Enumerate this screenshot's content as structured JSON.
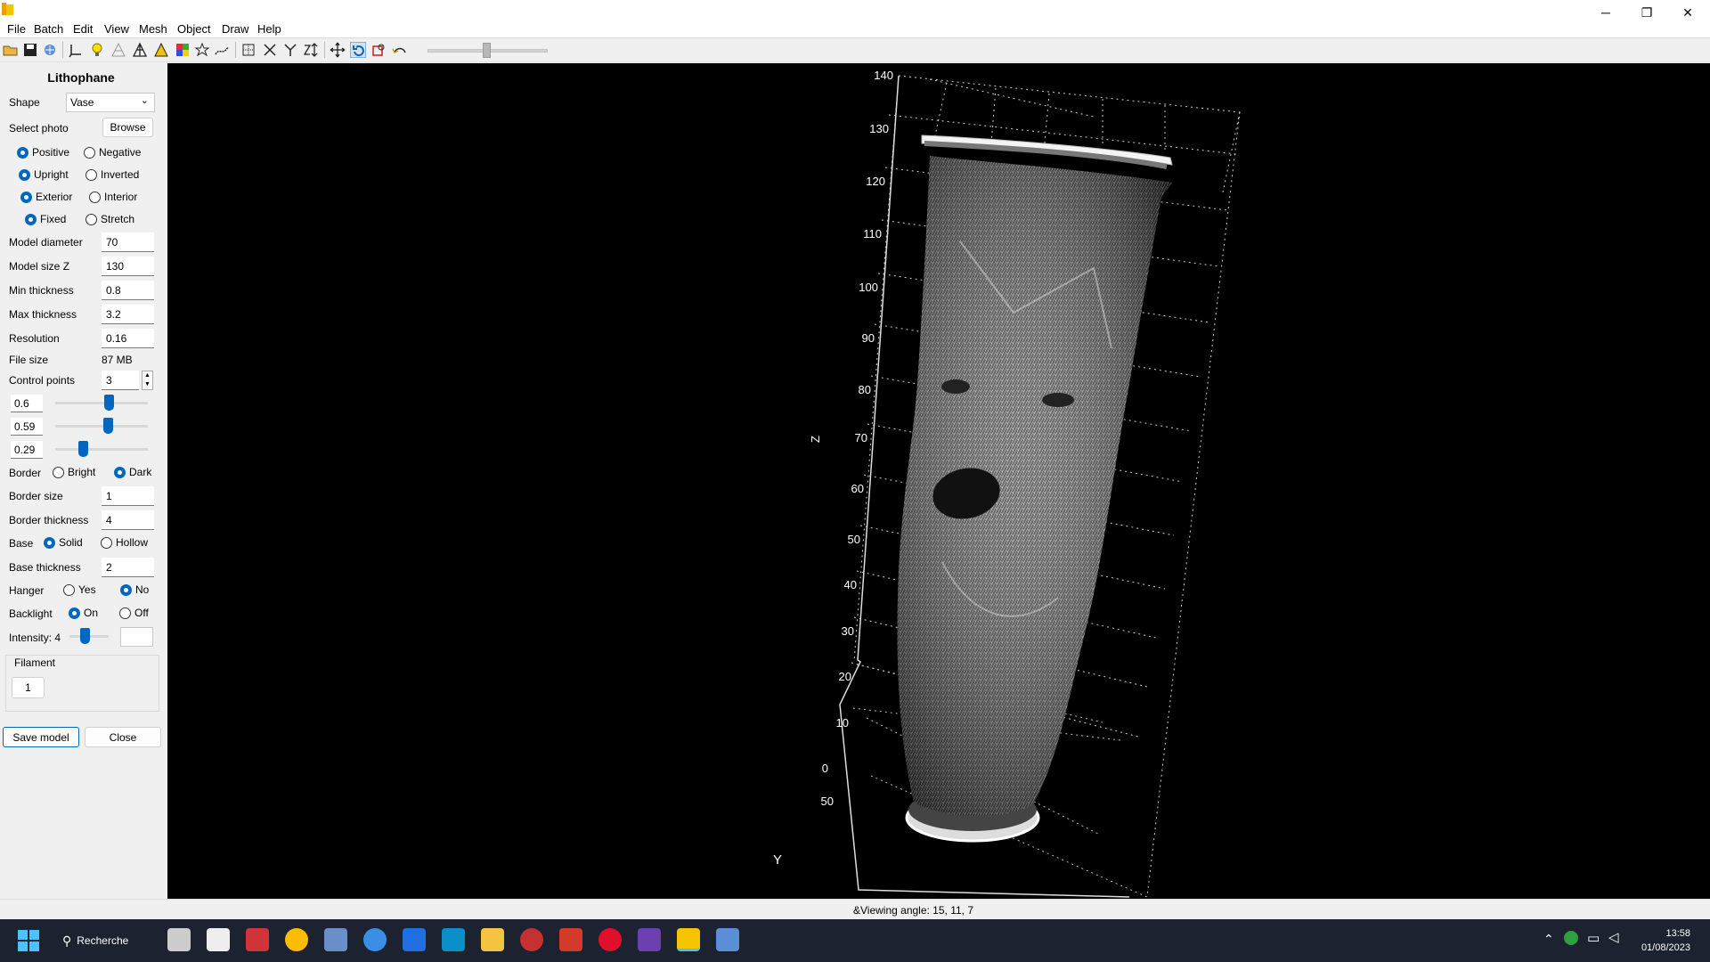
{
  "window": {
    "minimize": "─",
    "maximize": "❐",
    "close": "✕"
  },
  "menu": [
    "File",
    "Batch",
    "Edit",
    "View",
    "Mesh",
    "Object",
    "Draw",
    "Help"
  ],
  "panel": {
    "title": "Lithophane",
    "shape_label": "Shape",
    "shape_value": "Vase",
    "select_photo_label": "Select photo",
    "browse_label": "Browse",
    "positive": "Positive",
    "negative": "Negative",
    "upright": "Upright",
    "inverted": "Inverted",
    "exterior": "Exterior",
    "interior": "Interior",
    "fixed": "Fixed",
    "stretch": "Stretch",
    "model_diameter_label": "Model diameter",
    "model_diameter": "70",
    "model_size_z_label": "Model size Z",
    "model_size_z": "130",
    "min_thickness_label": "Min thickness",
    "min_thickness": "0.8",
    "max_thickness_label": "Max thickness",
    "max_thickness": "3.2",
    "resolution_label": "Resolution",
    "resolution": "0.16",
    "file_size_label": "File size",
    "file_size": "87 MB",
    "control_points_label": "Control points",
    "control_points": "3",
    "cp_values": [
      "0.6",
      "0.59",
      "0.29"
    ],
    "border_label": "Border",
    "bright": "Bright",
    "dark": "Dark",
    "border_size_label": "Border size",
    "border_size": "1",
    "border_thickness_label": "Border thickness",
    "border_thickness": "4",
    "base_label": "Base",
    "solid": "Solid",
    "hollow": "Hollow",
    "base_thickness_label": "Base thickness",
    "base_thickness": "2",
    "hanger_label": "Hanger",
    "yes": "Yes",
    "no": "No",
    "backlight_label": "Backlight",
    "on": "On",
    "off": "Off",
    "intensity_label": "Intensity: 4",
    "filament_label": "Filament",
    "filament_value": "1",
    "save_label": "Save model",
    "close_label": "Close"
  },
  "viewport": {
    "z_axis_label": "Z",
    "y_axis_label": "Y",
    "z_ticks": [
      "140",
      "130",
      "120",
      "110",
      "100",
      "90",
      "80",
      "70",
      "60",
      "50",
      "40",
      "30",
      "20",
      "10",
      "0"
    ],
    "y_tick": "50"
  },
  "status": {
    "text": "&Viewing angle: 15, 11, 7"
  },
  "taskbar": {
    "search_label": "Recherche",
    "time": "13:58",
    "date": "01/08/2023"
  }
}
